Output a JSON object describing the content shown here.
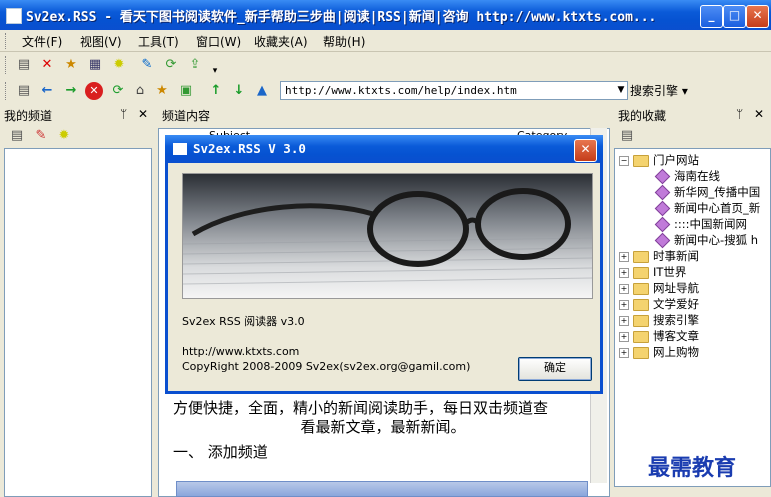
{
  "window": {
    "title": "Sv2ex.RSS - 看天下图书阅读软件_新手帮助三步曲|阅读|RSS|新闻|咨询 http://www.ktxts.com...",
    "min": "_",
    "max": "□",
    "close": "✕"
  },
  "menu": [
    "文件(F)",
    "视图(V)",
    "工具(T)",
    "窗口(W)",
    "收藏夹(A)",
    "帮助(H)"
  ],
  "address": {
    "value": "http://www.ktxts.com/help/index.htm"
  },
  "search": {
    "label": "搜索引擎"
  },
  "panes": {
    "left": {
      "title": "我的频道"
    },
    "middle": {
      "title": "频道内容",
      "col1": "Subject",
      "col2": "Category"
    },
    "right": {
      "title": "我的收藏"
    },
    "pin": "ᛘ",
    "close": "✕"
  },
  "favorites": {
    "root": "门户网站",
    "children": [
      "海南在线",
      "新华网_传播中国",
      "新闻中心首页_新",
      "::::中国新闻网",
      "新闻中心-搜狐 h"
    ],
    "folders": [
      "时事新闻",
      "IT世界",
      "网址导航",
      "文学爱好",
      "搜索引擎",
      "博客文章",
      "网上购物"
    ]
  },
  "article": {
    "line1": "方便快捷，全面，精小的新闻阅读助手，每日双击频道查",
    "line2": "看最新文章，最新新闻。",
    "line3": "一、  添加频道"
  },
  "dialog": {
    "title": "Sv2ex.RSS V 3.0",
    "product": "Sv2ex RSS 阅读器 v3.0",
    "url": "http://www.ktxts.com",
    "copyright": "CopyRight 2008-2009 Sv2ex(sv2ex.org@gamil.com)",
    "ok": "确定"
  },
  "watermark": "最需教育",
  "colors": {
    "titlebar": "#0a5ad8",
    "selection": "#316ac5"
  }
}
